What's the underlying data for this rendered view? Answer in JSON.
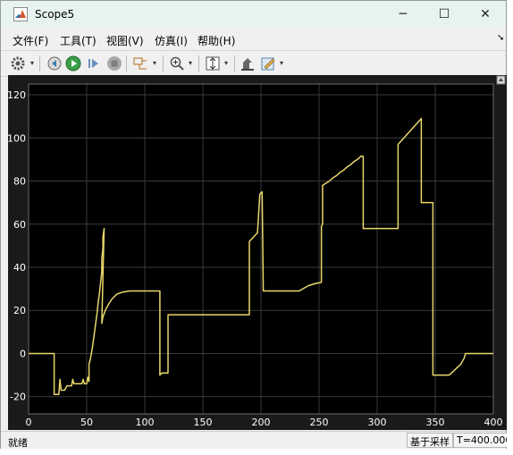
{
  "window": {
    "title": "Scope5",
    "minimize_glyph": "─",
    "maximize_glyph": "☐",
    "close_glyph": "✕"
  },
  "menu": [
    {
      "label": "文件(F)"
    },
    {
      "label": "工具(T)"
    },
    {
      "label": "视图(V)"
    },
    {
      "label": "仿真(I)"
    },
    {
      "label": "帮助(H)"
    }
  ],
  "toolbar": {
    "icons": [
      "gear-icon",
      "parameters-icon",
      "run-icon",
      "step-forward-icon",
      "stop-icon",
      "signal-selector-icon",
      "zoom-in-icon",
      "autoscale-icon",
      "highlight-block-icon",
      "style-edit-icon"
    ]
  },
  "status": {
    "left": "就绪",
    "mode": "基于采样",
    "time": "T=400.000"
  },
  "colors": {
    "plot_background": "#000000",
    "signal": "#e8d86a",
    "grid": "#3a3a3a",
    "axis_text": "#ffffff"
  },
  "chart_data": {
    "type": "line",
    "xlim": [
      0,
      400
    ],
    "ylim": [
      -28,
      125
    ],
    "xticks": [
      0,
      50,
      100,
      150,
      200,
      250,
      300,
      350,
      400
    ],
    "yticks": [
      -20,
      0,
      20,
      40,
      60,
      80,
      100,
      120
    ],
    "grid": true,
    "series": [
      {
        "points": [
          [
            0,
            0
          ],
          [
            22,
            0
          ],
          [
            22,
            -19
          ],
          [
            26,
            -19
          ],
          [
            27,
            -12
          ],
          [
            28,
            -17
          ],
          [
            31,
            -17
          ],
          [
            33,
            -15
          ],
          [
            37,
            -15
          ],
          [
            38,
            -12
          ],
          [
            39,
            -14
          ],
          [
            46,
            -14
          ],
          [
            47,
            -12
          ],
          [
            48,
            -14
          ],
          [
            50,
            -14
          ],
          [
            51,
            -11
          ],
          [
            52,
            -13
          ],
          [
            52,
            -5
          ],
          [
            53,
            -3
          ],
          [
            54,
            0
          ],
          [
            55,
            3
          ],
          [
            56,
            7
          ],
          [
            57,
            11
          ],
          [
            58,
            15
          ],
          [
            59,
            19
          ],
          [
            60,
            24
          ],
          [
            61,
            28
          ],
          [
            62,
            33
          ],
          [
            63,
            38
          ],
          [
            63,
            44
          ],
          [
            64,
            49
          ],
          [
            64,
            54
          ],
          [
            65,
            58
          ],
          [
            63,
            14
          ],
          [
            64,
            17
          ],
          [
            66,
            20
          ],
          [
            69,
            23
          ],
          [
            72,
            25.5
          ],
          [
            76,
            27.5
          ],
          [
            81,
            28.5
          ],
          [
            87,
            29
          ],
          [
            113,
            29
          ],
          [
            113,
            -10
          ],
          [
            115,
            -9
          ],
          [
            120,
            -9
          ],
          [
            120,
            18
          ],
          [
            190,
            18
          ],
          [
            190,
            52
          ],
          [
            197,
            56
          ],
          [
            199,
            74
          ],
          [
            201,
            75
          ],
          [
            202,
            29
          ],
          [
            233,
            29
          ],
          [
            236,
            30
          ],
          [
            241,
            31.5
          ],
          [
            247,
            32.5
          ],
          [
            252,
            33
          ],
          [
            252,
            59
          ],
          [
            253,
            60
          ],
          [
            253,
            78
          ],
          [
            256,
            79
          ],
          [
            259,
            80
          ],
          [
            262,
            81.5
          ],
          [
            265,
            82.5
          ],
          [
            268,
            84
          ],
          [
            271,
            85
          ],
          [
            274,
            86.5
          ],
          [
            277,
            87.5
          ],
          [
            280,
            89
          ],
          [
            283,
            90
          ],
          [
            286,
            91.5
          ],
          [
            288,
            91.5
          ],
          [
            288,
            58
          ],
          [
            318,
            58
          ],
          [
            318,
            97
          ],
          [
            338,
            109
          ],
          [
            338,
            70
          ],
          [
            348,
            70
          ],
          [
            348,
            -10
          ],
          [
            362,
            -10
          ],
          [
            363,
            -9.5
          ],
          [
            366,
            -8
          ],
          [
            369,
            -6.5
          ],
          [
            372,
            -5
          ],
          [
            374,
            -3
          ],
          [
            375,
            -2
          ],
          [
            376,
            0
          ],
          [
            400,
            0
          ]
        ]
      }
    ]
  }
}
